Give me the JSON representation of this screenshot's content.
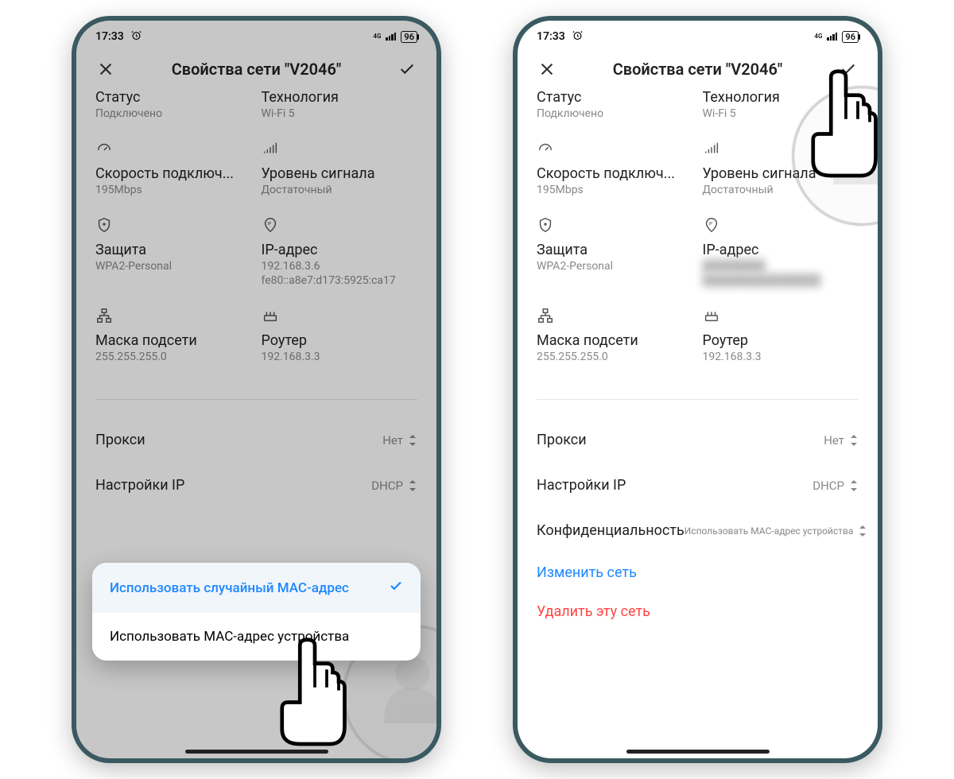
{
  "status": {
    "time": "17:33",
    "battery": "96",
    "net": "4G"
  },
  "header": {
    "title": "Свойства сети \"V2046\""
  },
  "fields": {
    "status_label": "Статус",
    "status_value": "Подключено",
    "tech_label": "Технология",
    "tech_value": "Wi-Fi 5",
    "speed_label": "Скорость подключ...",
    "speed_value": "195Mbps",
    "signal_label": "Уровень сигнала",
    "signal_value": "Достаточный",
    "security_label": "Защита",
    "security_value": "WPA2-Personal",
    "ip_label": "IP-адрес",
    "ip_value1": "192.168.3.6",
    "ip_value2": "fe80::a8e7:d173:5925:ca17",
    "mask_label": "Маска подсети",
    "mask_value": "255.255.255.0",
    "router_label": "Роутер",
    "router_value": "192.168.3.3"
  },
  "settings": {
    "proxy_label": "Прокси",
    "proxy_value": "Нет",
    "ip_label": "Настройки IP",
    "ip_value": "DHCP",
    "privacy_label": "Конфиденциальность",
    "privacy_value": "Использовать MAC-адрес устройства",
    "change_link": "Изменить сеть",
    "delete_link": "Удалить эту сеть"
  },
  "popup": {
    "option1": "Использовать случайный MAC-адрес",
    "option2": "Использовать MAC-адрес устройства"
  }
}
